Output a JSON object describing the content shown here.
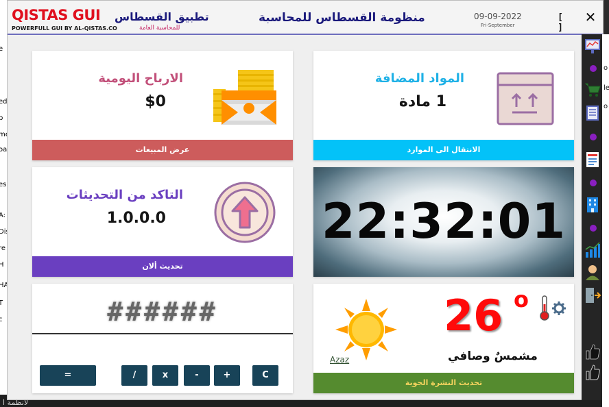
{
  "window": {
    "brand_title": "QISTAS GUI",
    "brand_subtitle": "POWERFULL GUI BY AL-QISTAS.CO",
    "app_name": "تطبيق القسطاس",
    "app_subtitle": "للمحاسبة العامة",
    "system_title": "منظومة القسطاس للمحاسبة",
    "date": "09-09-2022",
    "day_month": "Fri-September",
    "maximize_label": "[ ]",
    "close_label": "✕"
  },
  "cards": {
    "profit": {
      "title": "الارباح اليومية",
      "value": "$0",
      "button": "عرض المبيعات",
      "color": "#cd5c5c",
      "title_color": "#c2507a",
      "icon": "money-stack-icon"
    },
    "items": {
      "title": "المواد المضافة",
      "value": "1 مادة",
      "button": "الانتقال الى الموارد",
      "color": "#03c2f8",
      "title_color": "#1fb1e6",
      "icon": "package-box-icon"
    },
    "update": {
      "title": "التاكد من التحديثات",
      "value": "1.0.0.0",
      "button": "تحديث ألان",
      "color": "#6a3fc0",
      "title_color": "#6a3fc0",
      "icon": "upload-arrow-icon"
    },
    "clock": {
      "time": "22:32:01"
    },
    "calculator": {
      "display": "######",
      "keys": {
        "equals": "=",
        "divide": "/",
        "multiply": "x",
        "minus": "-",
        "plus": "+",
        "clear": "C"
      },
      "key_color": "#184358"
    },
    "weather": {
      "temperature": "26",
      "degree_symbol": "o",
      "description": "مشمسٌ وصافي",
      "city": "Azaz",
      "button": "تحديث النشرة الجوية",
      "color": "#558b2f",
      "icon": "sun-icon"
    }
  },
  "sidebar": {
    "icons": [
      "chart-board-icon",
      "shopping-cart-icon",
      "document-list-icon",
      "invoice-icon",
      "building-icon",
      "bar-chart-icon",
      "user-avatar-icon",
      "exit-door-icon",
      "thumbs-up-icon",
      "thumbs-up-outline-icon"
    ]
  },
  "background": {
    "taskbar_text": "لأنظمة ا"
  }
}
